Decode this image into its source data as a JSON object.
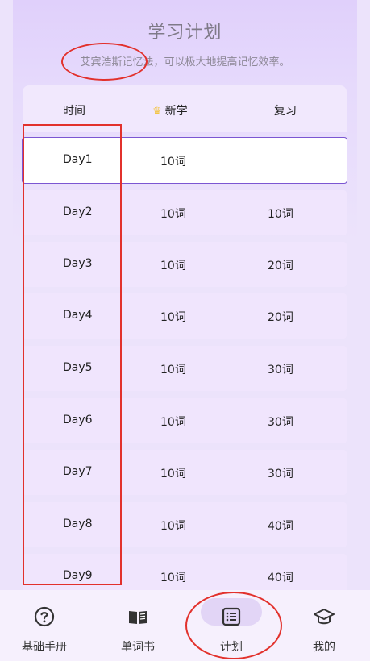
{
  "header": {
    "title": "学习计划",
    "subtitle": "艾宾浩斯记忆法，可以极大地提高记忆效率。"
  },
  "table": {
    "columns": [
      "时间",
      "新学",
      "复习"
    ],
    "new_icon": "crown-icon",
    "rows": [
      {
        "day": "Day1",
        "new": "10词",
        "review": ""
      },
      {
        "day": "Day2",
        "new": "10词",
        "review": "10词"
      },
      {
        "day": "Day3",
        "new": "10词",
        "review": "20词"
      },
      {
        "day": "Day4",
        "new": "10词",
        "review": "20词"
      },
      {
        "day": "Day5",
        "new": "10词",
        "review": "30词"
      },
      {
        "day": "Day6",
        "new": "10词",
        "review": "30词"
      },
      {
        "day": "Day7",
        "new": "10词",
        "review": "30词"
      },
      {
        "day": "Day8",
        "new": "10词",
        "review": "40词"
      },
      {
        "day": "Day9",
        "new": "10词",
        "review": "40词"
      }
    ]
  },
  "tabbar": {
    "items": [
      {
        "label": "基础手册",
        "icon": "question-circle-icon"
      },
      {
        "label": "单词书",
        "icon": "open-book-icon"
      },
      {
        "label": "计划",
        "icon": "list-icon",
        "selected": true
      },
      {
        "label": "我的",
        "icon": "graduation-cap-icon"
      }
    ]
  },
  "colors": {
    "accent": "#7b56d2",
    "annotation": "#e2312c",
    "background": "#ece3fb"
  }
}
